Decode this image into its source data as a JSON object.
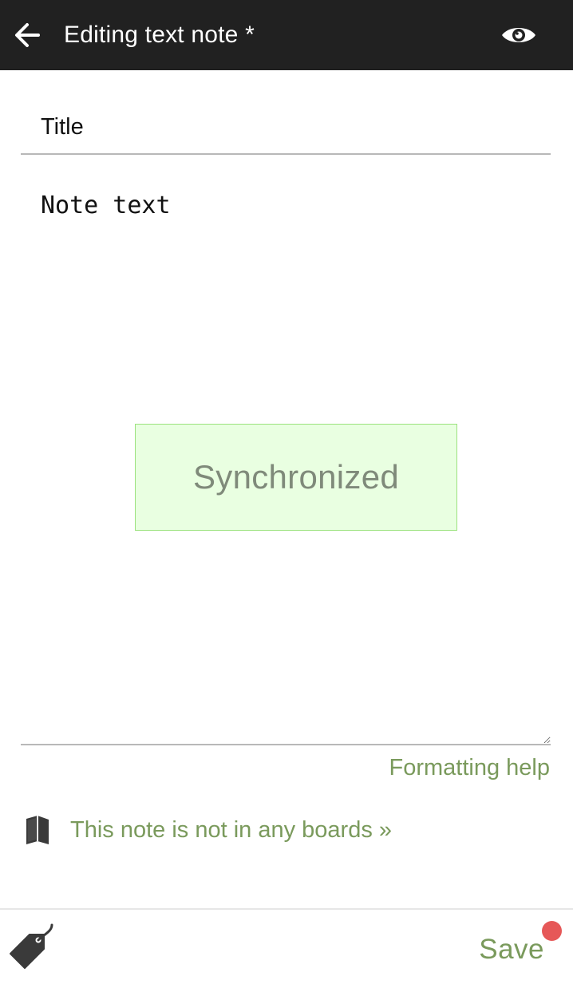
{
  "header": {
    "title": "Editing text note *",
    "back_icon": "arrow-left-icon",
    "preview_icon": "eye-icon",
    "background": "#212121"
  },
  "editor": {
    "title_placeholder": "Title",
    "title_value": "",
    "text_placeholder": "Note text",
    "text_value": ""
  },
  "toast": {
    "text": "Synchronized",
    "background": "#e9ffe1",
    "border": "#9be27e"
  },
  "links": {
    "formatting_help": "Formatting help",
    "boards": "This note is not in any boards »",
    "boards_icon": "book-icon"
  },
  "footer": {
    "tag_icon": "tag-icon",
    "save_label": "Save",
    "unsaved_indicator_color": "#e65858"
  },
  "colors": {
    "accent": "#7a9a5c"
  }
}
